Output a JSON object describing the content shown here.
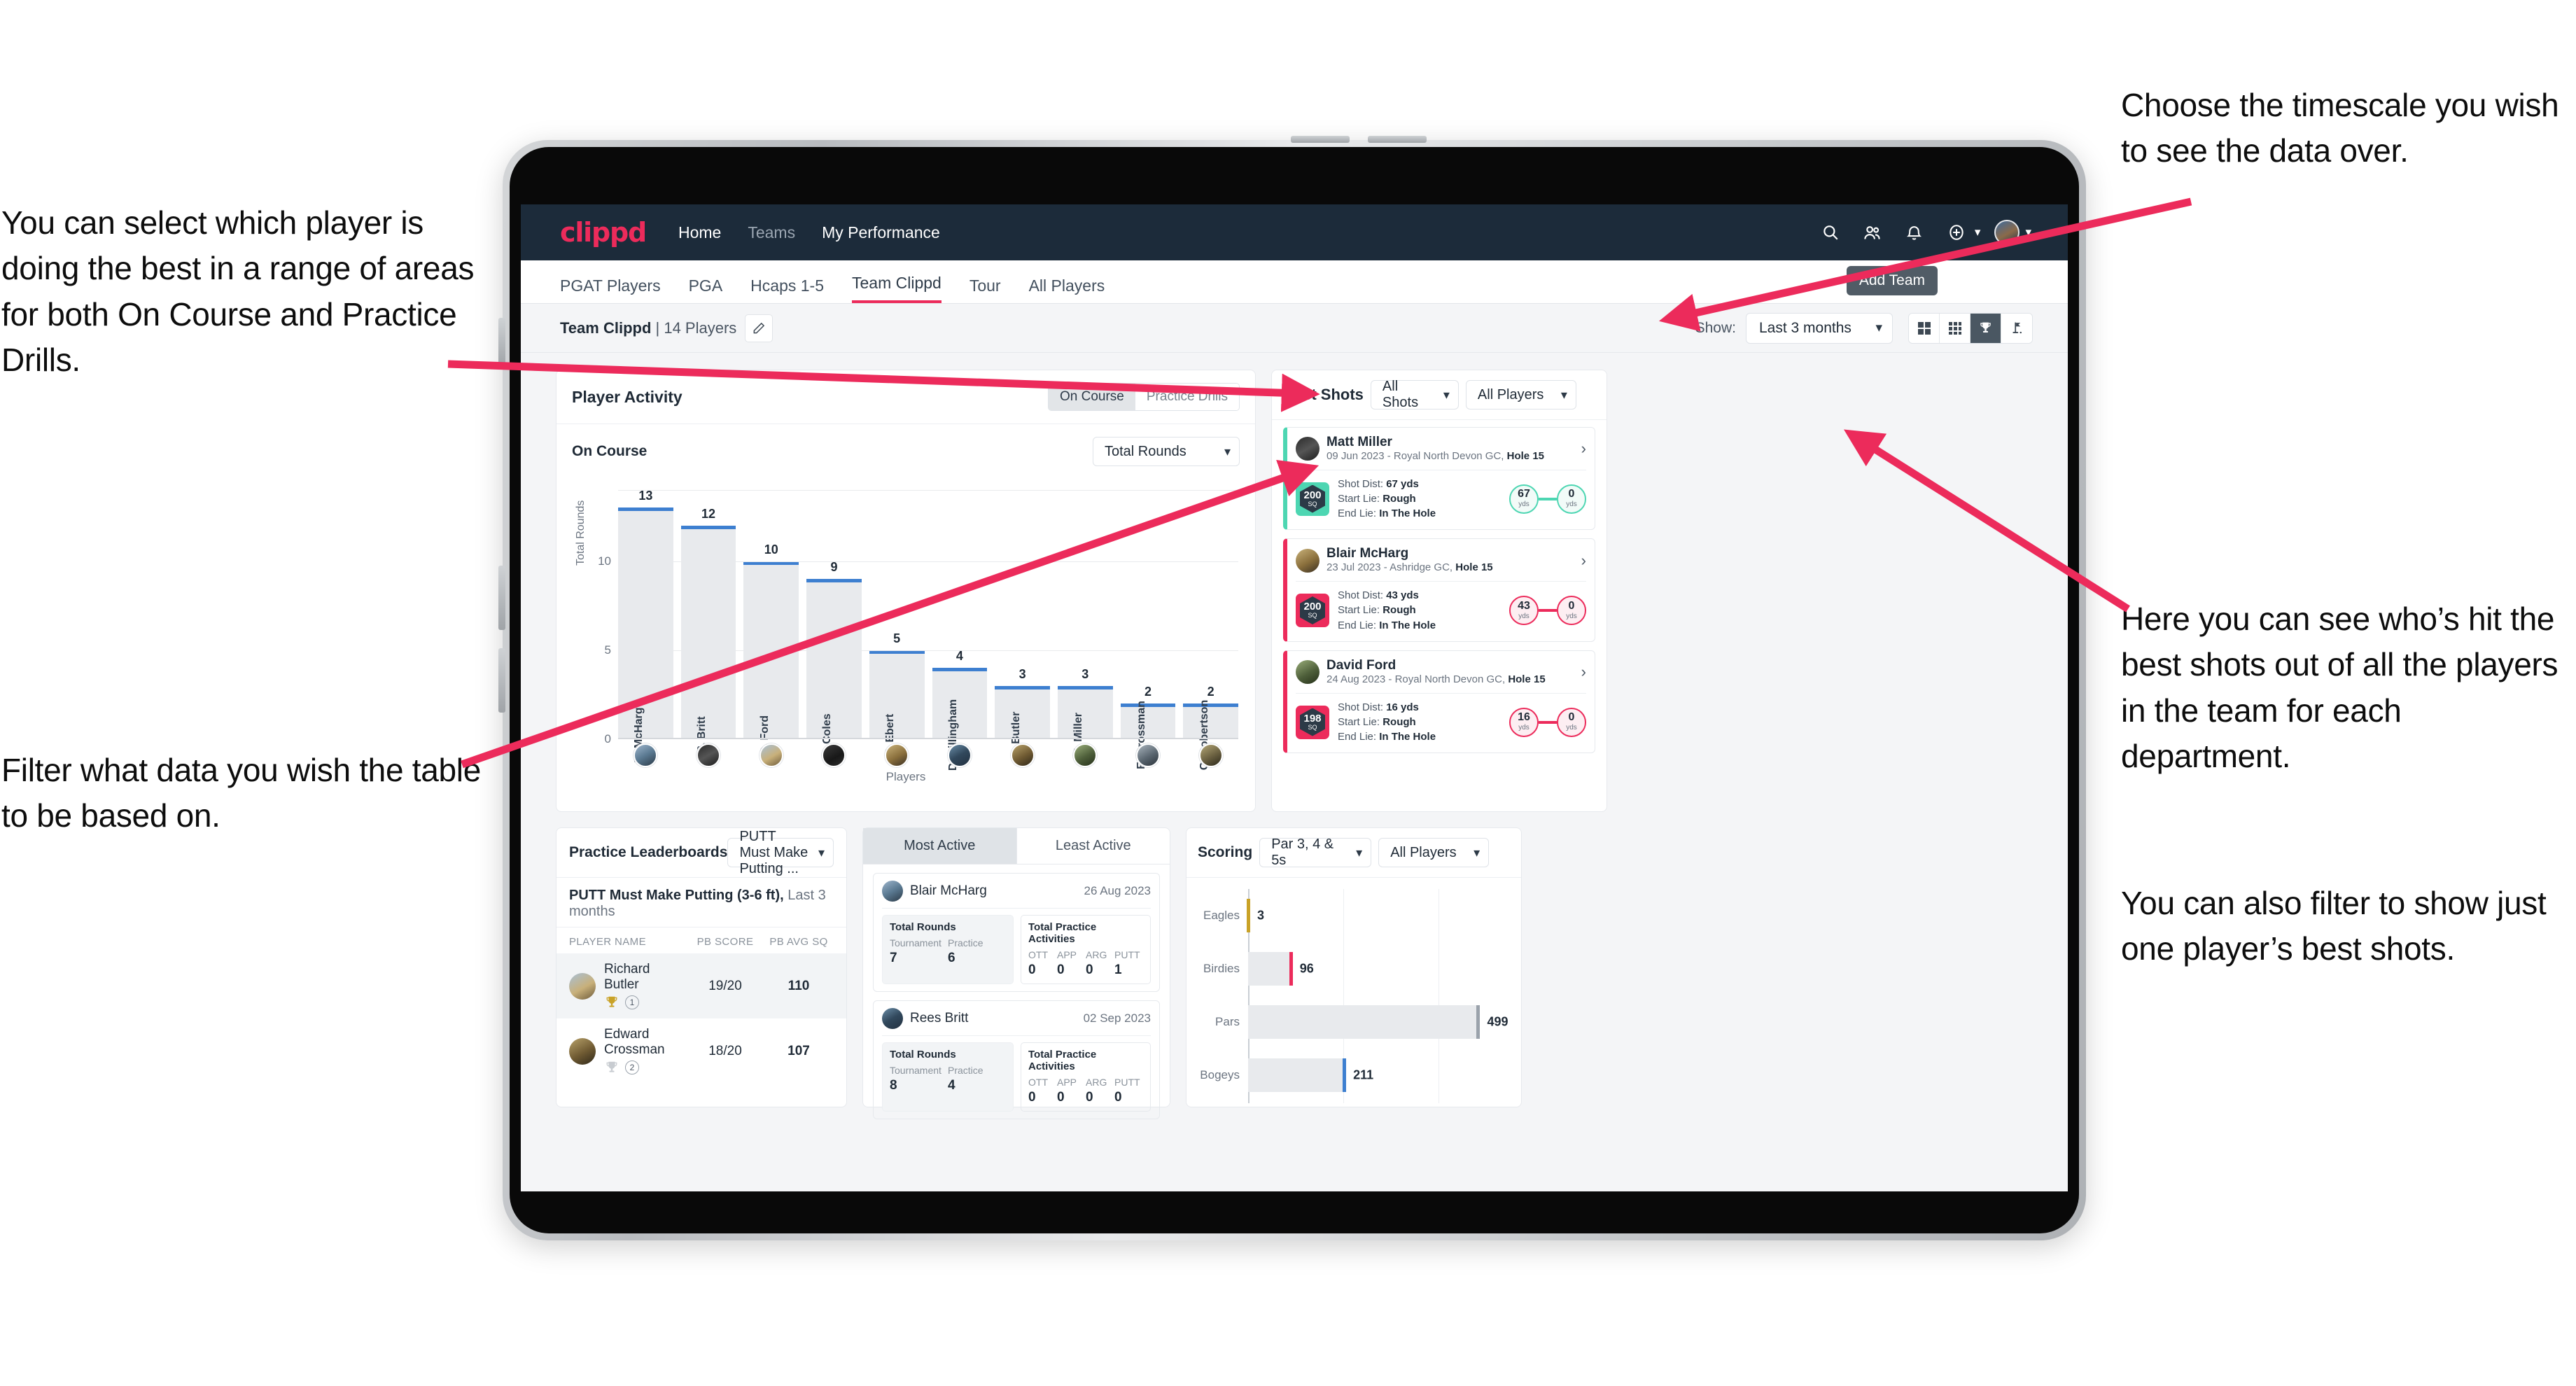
{
  "annotations": {
    "left_top": "You can select which player is doing the best in a range of areas for both On Course and Practice Drills.",
    "left_bottom": "Filter what data you wish the table to be based on.",
    "right_top": "Choose the timescale you wish to see the data over.",
    "right_middle": "Here you can see who’s hit the best shots out of all the players in the team for each department.",
    "right_bottom": "You can also filter to show just one player’s best shots."
  },
  "colors": {
    "brand_pink": "#ec2b5b",
    "nav_dark": "#1c2b3a",
    "bar_blue": "#3d7fd0",
    "teal": "#4dd6b2",
    "gold": "#c9a227"
  },
  "topnav": {
    "logo": "clippd",
    "links": [
      {
        "label": "Home",
        "dim": false
      },
      {
        "label": "Teams",
        "dim": true
      },
      {
        "label": "My Performance",
        "dim": false
      }
    ],
    "icons": [
      "search-icon",
      "people-icon",
      "bell-icon",
      "plus-circle-icon",
      "avatar"
    ]
  },
  "tabs": [
    {
      "label": "PGAT Players",
      "active": false
    },
    {
      "label": "PGA",
      "active": false
    },
    {
      "label": "Hcaps 1-5",
      "active": false
    },
    {
      "label": "Team Clippd",
      "active": true
    },
    {
      "label": "Tour",
      "active": false
    },
    {
      "label": "All Players",
      "active": false
    }
  ],
  "tooltip": {
    "add_team": "Add Team"
  },
  "subbar": {
    "team_name": "Team Clippd",
    "team_separator": " | ",
    "player_count": "14 Players",
    "edit_icon": "pencil-icon",
    "show_label": "Show:",
    "timescale_value": "Last 3 months",
    "view_toggles": [
      {
        "icon": "grid-4-icon",
        "active": false
      },
      {
        "icon": "grid-9-icon",
        "active": false
      },
      {
        "icon": "trophy-icon",
        "active": true
      },
      {
        "icon": "golf-flag-icon",
        "active": false
      }
    ]
  },
  "player_activity": {
    "title": "Player Activity",
    "segments": [
      {
        "label": "On Course",
        "active": true
      },
      {
        "label": "Practice Drills",
        "active": false
      }
    ],
    "sub_label": "On Course",
    "metric_value": "Total Rounds"
  },
  "chart_data": [
    {
      "type": "bar",
      "title": "Player Activity",
      "xlabel": "Players",
      "ylabel": "Total Rounds",
      "categories": [
        "B. McHarg",
        "R. Britt",
        "D. Ford",
        "J. Coles",
        "E. Ebert",
        "D. Billingham",
        "R. Butler",
        "M. Miller",
        "E. Crossman",
        "C. Robertson"
      ],
      "values": [
        13,
        12,
        10,
        9,
        5,
        4,
        3,
        3,
        2,
        2
      ],
      "ylim": [
        0,
        14
      ],
      "yticks": [
        0,
        5,
        10
      ],
      "grid": true,
      "legend": "none"
    },
    {
      "type": "bar",
      "orientation": "horizontal",
      "title": "Scoring",
      "categories": [
        "Eagles",
        "Birdies",
        "Pars",
        "Bogeys"
      ],
      "values": [
        3,
        96,
        499,
        211
      ],
      "bar_colors": [
        "#c9a227",
        "#ec2b5b",
        "#9aa2ab",
        "#3d7fd0"
      ],
      "xlim": [
        0,
        560
      ],
      "grid": true,
      "legend": "none"
    }
  ],
  "best_shots": {
    "title": "Best Shots",
    "shot_filter": "All Shots",
    "player_filter": "All Players",
    "shots": [
      {
        "player": "Matt Miller",
        "meta_prefix": "09 Jun 2023 - Royal North Devon GC, ",
        "hole": "Hole 15",
        "sq": "200",
        "sq_unit": "SQ",
        "accent": "teal",
        "shot_dist_label": "Shot Dist: ",
        "shot_dist": "67 yds",
        "start_lie_label": "Start Lie: ",
        "start_lie": "Rough",
        "end_lie_label": "End Lie: ",
        "end_lie": "In The Hole",
        "from_val": "67",
        "from_unit": "yds",
        "to_val": "0",
        "to_unit": "yds"
      },
      {
        "player": "Blair McHarg",
        "meta_prefix": "23 Jul 2023 - Ashridge GC, ",
        "hole": "Hole 15",
        "sq": "200",
        "sq_unit": "SQ",
        "accent": "pink",
        "shot_dist_label": "Shot Dist: ",
        "shot_dist": "43 yds",
        "start_lie_label": "Start Lie: ",
        "start_lie": "Rough",
        "end_lie_label": "End Lie: ",
        "end_lie": "In The Hole",
        "from_val": "43",
        "from_unit": "yds",
        "to_val": "0",
        "to_unit": "yds"
      },
      {
        "player": "David Ford",
        "meta_prefix": "24 Aug 2023 - Royal North Devon GC, ",
        "hole": "Hole 15",
        "sq": "198",
        "sq_unit": "SQ",
        "accent": "pink",
        "shot_dist_label": "Shot Dist: ",
        "shot_dist": "16 yds",
        "start_lie_label": "Start Lie: ",
        "start_lie": "Rough",
        "end_lie_label": "End Lie: ",
        "end_lie": "In The Hole",
        "from_val": "16",
        "from_unit": "yds",
        "to_val": "0",
        "to_unit": "yds"
      }
    ]
  },
  "practice_leaderboards": {
    "title": "Practice Leaderboards",
    "drill_select": "PUTT Must Make Putting ...",
    "subtitle_bold": "PUTT Must Make Putting (3-6 ft),",
    "subtitle_light": " Last 3 months",
    "columns": [
      "PLAYER NAME",
      "PB SCORE",
      "PB AVG SQ"
    ],
    "rows": [
      {
        "name": "Richard Butler",
        "rank": "1",
        "trophy": "gold",
        "pb_score": "19/20",
        "pb_avg_sq": "110"
      },
      {
        "name": "Edward Crossman",
        "rank": "2",
        "trophy": "silver",
        "pb_score": "18/20",
        "pb_avg_sq": "107"
      }
    ]
  },
  "activity_panel": {
    "tabs": [
      {
        "label": "Most Active",
        "active": true
      },
      {
        "label": "Least Active",
        "active": false
      }
    ],
    "entries": [
      {
        "name": "Blair McHarg",
        "date": "26 Aug 2023",
        "rounds_title": "Total Rounds",
        "rounds": [
          {
            "key": "Tournament",
            "value": "7"
          },
          {
            "key": "Practice",
            "value": "6"
          }
        ],
        "practice_title": "Total Practice Activities",
        "practice": [
          {
            "key": "OTT",
            "value": "0"
          },
          {
            "key": "APP",
            "value": "0"
          },
          {
            "key": "ARG",
            "value": "0"
          },
          {
            "key": "PUTT",
            "value": "1"
          }
        ]
      },
      {
        "name": "Rees Britt",
        "date": "02 Sep 2023",
        "rounds_title": "Total Rounds",
        "rounds": [
          {
            "key": "Tournament",
            "value": "8"
          },
          {
            "key": "Practice",
            "value": "4"
          }
        ],
        "practice_title": "Total Practice Activities",
        "practice": [
          {
            "key": "OTT",
            "value": "0"
          },
          {
            "key": "APP",
            "value": "0"
          },
          {
            "key": "ARG",
            "value": "0"
          },
          {
            "key": "PUTT",
            "value": "0"
          }
        ]
      }
    ]
  },
  "scoring": {
    "title": "Scoring",
    "par_filter": "Par 3, 4 & 5s",
    "player_filter": "All Players"
  }
}
